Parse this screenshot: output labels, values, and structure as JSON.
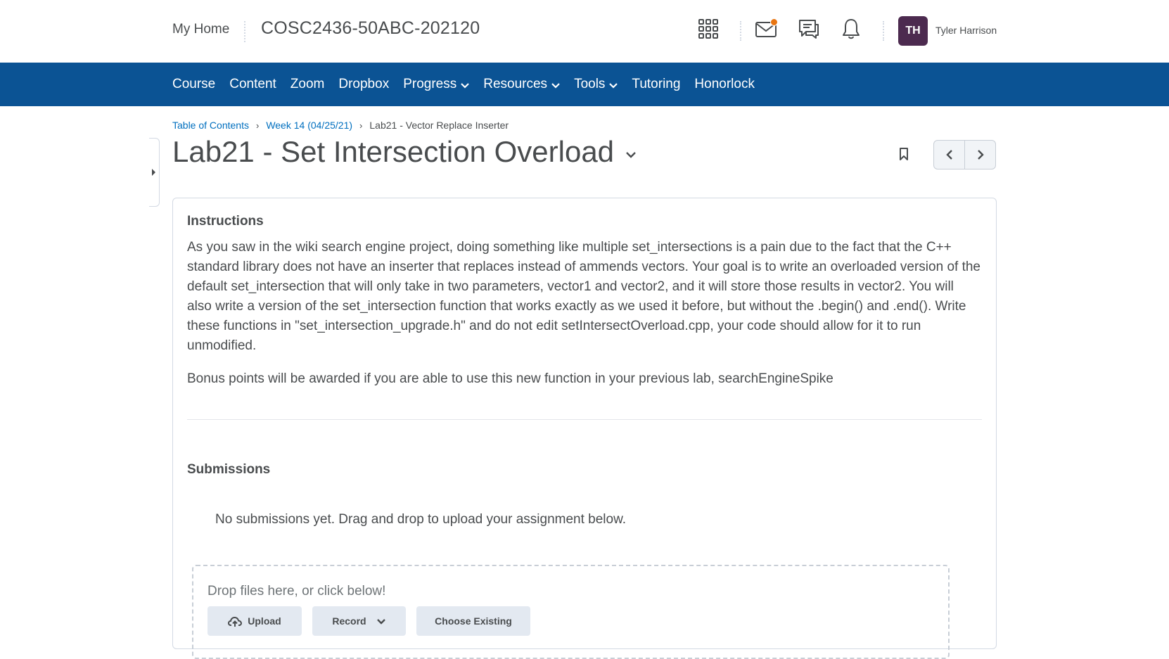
{
  "minibar": {
    "home": "My Home",
    "course": "COSC2436-50ABC-202120",
    "icons": [
      "waffle-icon",
      "envelope-icon",
      "chat-icon",
      "bell-icon"
    ],
    "user_initials": "TH",
    "user_name": "Tyler Harrison"
  },
  "nav": {
    "items": [
      {
        "label": "Course"
      },
      {
        "label": "Content"
      },
      {
        "label": "Zoom"
      },
      {
        "label": "Dropbox"
      },
      {
        "label": "Progress",
        "dropdown": true
      },
      {
        "label": "Resources",
        "dropdown": true
      },
      {
        "label": "Tools",
        "dropdown": true
      },
      {
        "label": "Tutoring"
      },
      {
        "label": "Honorlock"
      }
    ]
  },
  "breadcrumb": {
    "items": [
      "Table of Contents",
      "Week 14 (04/25/21)"
    ],
    "current": "Lab21 - Vector Replace Inserter"
  },
  "page": {
    "title": "Lab21 - Set Intersection Overload"
  },
  "instructions": {
    "heading": "Instructions",
    "paragraphs": [
      "As you saw in the wiki search engine project, doing something like multiple set_intersections is a pain due to the fact that the C++ standard library does not have an inserter that replaces instead of ammends vectors. Your goal is to write an overloaded version of the default set_intersection that will only take in two parameters, vector1 and vector2, and it will store those results in vector2. You will also write a version of the set_intersection function that works exactly as we used it before, but without the .begin() and .end(). Write these functions in \"set_intersection_upgrade.h\" and do not edit setIntersectOverload.cpp, your code should allow for it to run unmodified.",
      "Bonus points will be awarded if you are able to use this new function in your previous lab, searchEngineSpike"
    ]
  },
  "submissions": {
    "heading": "Submissions",
    "empty_text": "No submissions yet. Drag and drop to upload your assignment below.",
    "drop_text": "Drop files here, or click below!",
    "upload_label": "Upload",
    "record_label": "Record",
    "choose_label": "Choose Existing"
  },
  "colors": {
    "nav_bg": "#0b5394",
    "link": "#006fbf",
    "avatar_bg": "#4c2a4f",
    "notification_dot": "#e87511"
  }
}
